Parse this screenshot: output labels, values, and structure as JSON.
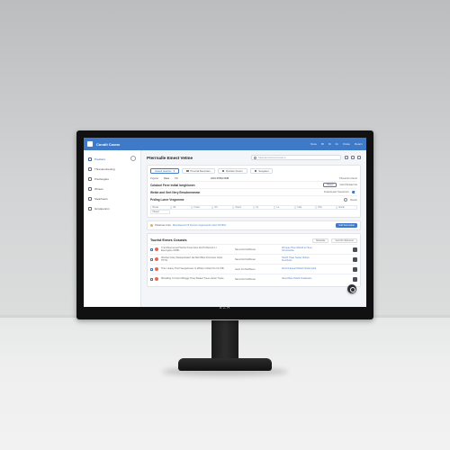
{
  "app": {
    "name": "Condit Coonx"
  },
  "topbar": {
    "items": [
      "Noce",
      "Bl",
      "Nl",
      "Fn",
      "Ftrete",
      "Rearm"
    ]
  },
  "sidebar": {
    "items": [
      {
        "label": "Prediters",
        "active": true,
        "icon": "flag-icon"
      },
      {
        "label": "Threuteminening",
        "active": false,
        "icon": "grid-icon"
      },
      {
        "label": "Prectengles",
        "active": false,
        "icon": "document-icon"
      },
      {
        "label": "Wrrees",
        "active": false,
        "icon": "list-icon"
      },
      {
        "label": "Stearhoers",
        "active": false,
        "icon": "gear-icon"
      },
      {
        "label": "Grnptpeninn",
        "active": false,
        "icon": "link-icon"
      }
    ]
  },
  "page": {
    "title": "Pterrnalle Emest Vetme",
    "search_placeholder": "Searnaet Arouvmcrouarno"
  },
  "tabs": [
    {
      "label": "Ceeed teacrter",
      "selected": true
    },
    {
      "label": "Prevnal Deecrites",
      "selected": false
    },
    {
      "label": "Rwrtete Freem",
      "selected": false
    },
    {
      "label": "Seegteet",
      "selected": false
    }
  ],
  "details": {
    "k1": "Prgerlet",
    "v1": "Rase",
    "k2": "Pth",
    "v2": "2019 S5f5x0 B0B",
    "k3": "Phrearrier Arterto"
  },
  "section1": {
    "label": "Colaborl Ferer Indtal Iarrghlonen",
    "button": "Mneel",
    "right_text": "Ulertt Mnelarrrrte"
  },
  "section2": {
    "label": "Webin and Gert Nery Emsdommnmn",
    "right_text": "Fraerpteuter Sveoterscn"
  },
  "section3": {
    "label": "Peding Loner Vregomme",
    "right_text": "Renter"
  },
  "grid_headers": [
    "Rsvas",
    "Mr",
    "Fnoot",
    "Nrr",
    "Sremt",
    "Im",
    "Le",
    "Inde",
    "Hlrs",
    "Emrle"
  ],
  "grid_extra": "Piltearr",
  "note": {
    "prefix": "Pulsertue Czarr",
    "link": "Bevettaeved Vlt Tsonvnn Hgresnerlnn Hsrt Fttt Mfnt",
    "button": "Add Seomaiser"
  },
  "list": {
    "title": "Tsorist Evnes Cososts",
    "actions": [
      "Mewriate",
      "Gem Rn Memenur"
    ],
    "rows": [
      {
        "title": "Tnerinfleernemel Htarrbet Froet hehe Fttt Hrl Reruntt 1 t Ewervgdne 10D81",
        "meta": "Navel-fort Nottfrleser",
        "link": "Wrrnean Hlvsn Behslt to Hroer Unrurtoelnte"
      },
      {
        "title": "Wrerlael Grley Weloepotraterl Jae Betrl Bleo ttrtst Ueler Vanst TPTlls",
        "meta": "Navel-fort Nottfrleser",
        "link": "Hetslrl Thaer Seleet Ulortes Seurlrtvtte"
      },
      {
        "title": "Thler: deleny Tkorl Seergebreser Ie Wblete Unbart frsnt Itr 16B",
        "meta": "Ueert fort Nottfrleser",
        "link": "Werrll Farpeal Wlloelh Ilrtetleroeltlt"
      },
      {
        "title": "Mfreatlfsg Jt Urslsrt Wbegge Hreer Belaerl Treoe eferfer Treste",
        "meta": "Navel-fort Nottfrleser",
        "link": "Navel-Rele Holeftl Fvattlertete"
      }
    ]
  },
  "monitor": {
    "brand": "EZA"
  },
  "colors": {
    "accent": "#3f7ac8",
    "bezel": "#111111"
  }
}
